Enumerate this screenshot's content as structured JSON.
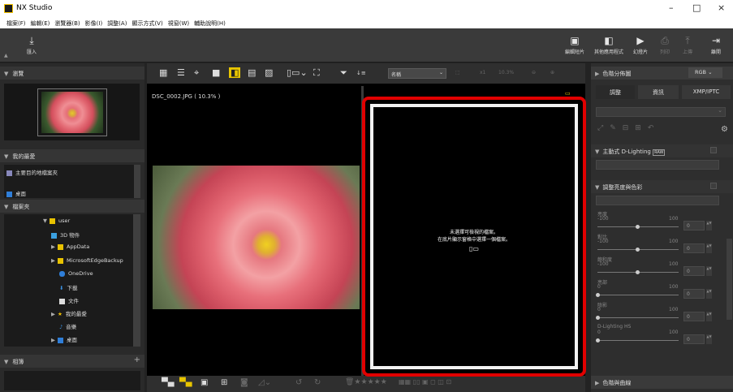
{
  "app": {
    "title": "NX Studio"
  },
  "window_controls": {
    "minimize": "–",
    "maximize": "□",
    "close": "×"
  },
  "menu": [
    "檔案(F)",
    "編輯(E)",
    "瀏覽器(B)",
    "影像(I)",
    "調整(A)",
    "顯示方式(V)",
    "視窗(W)",
    "輔助說明(H)"
  ],
  "toolbar": {
    "import": "匯入",
    "edit_video": "編輯短片",
    "other_apps": "其他應用程式",
    "slideshow": "幻燈片",
    "print": "列印",
    "upload": "上傳",
    "exit": "離開"
  },
  "left_panel": {
    "browse": "瀏覽",
    "favorites": "我的最愛",
    "fav_items": [
      "主要目的地檔案夾",
      "桌面"
    ],
    "folders": "檔案夾",
    "tree": [
      "user",
      "3D 物件",
      "AppData",
      "MicrosoftEdgeBackup",
      "OneDrive",
      "下載",
      "文件",
      "我的最愛",
      "音樂",
      "桌面"
    ],
    "albums": "相簿"
  },
  "center": {
    "sort_label": "名稱",
    "zoom": "10.3%",
    "filename": "DSC_0002.JPG ( 10.3% )",
    "empty_line1": "未選擇可檢視的檔案。",
    "empty_line2": "在底片顯示窗格中選擇一個檔案。"
  },
  "right_panel": {
    "histogram": "色階分佈圖",
    "channel": "RGB",
    "tabs": [
      "調整",
      "資訊",
      "XMP/IPTC"
    ],
    "active_dlighting": "主動式 D-Lighting",
    "raw_badge": "RAW",
    "brightness_color": "調整亮度與色彩",
    "sliders": [
      {
        "label": "亮度",
        "min": "-100",
        "max": "100",
        "value": "0"
      },
      {
        "label": "對比",
        "min": "-100",
        "max": "100",
        "value": "0"
      },
      {
        "label": "飽和度",
        "min": "-100",
        "max": "100",
        "value": "0"
      },
      {
        "label": "亮部",
        "min": "0",
        "max": "100",
        "value": "0"
      },
      {
        "label": "陰影",
        "min": "0",
        "max": "100",
        "value": "0"
      },
      {
        "label": "D-Lighting HS",
        "min": "0",
        "max": "100",
        "value": "0"
      }
    ],
    "tone_curve": "色階與曲線"
  },
  "colors": {
    "accent": "#e8c500",
    "highlight_red": "#e10000"
  }
}
